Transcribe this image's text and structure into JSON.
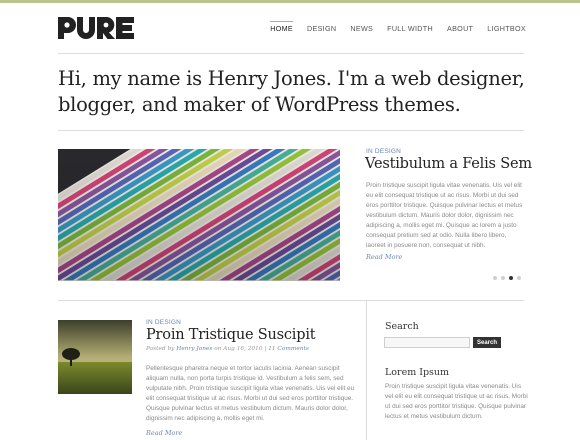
{
  "header": {
    "logo": "PURE",
    "nav": [
      {
        "label": "HOME",
        "active": true
      },
      {
        "label": "DESIGN",
        "active": false
      },
      {
        "label": "NEWS",
        "active": false
      },
      {
        "label": "FULL WIDTH",
        "active": false
      },
      {
        "label": "ABOUT",
        "active": false
      },
      {
        "label": "LIGHTBOX",
        "active": false
      }
    ]
  },
  "intro": "Hi, my name is Henry Jones. I'm a web designer, blogger, and maker of WordPress themes.",
  "featured": {
    "category": "IN DESIGN",
    "title": "Vestibulum a Felis Sem",
    "text": "Proin tristique suscipit ligula vitae venenatis. Uis vel elit eu elit consequat tristique ut ac risus. Morbi ut dui sed eros porttitor tristique. Quisque pulvinar lectus et metus vestibulum dictum. Mauris dolor dolor, dignissim nec adipiscing a, mollis eget mi. Quisque ac lorem a justo consequat pretium sed at odio. Nulla libero libero, laoreet in posuere non, consequat ut nibh.",
    "read_more": "Read More",
    "slides": 4,
    "active_slide": 3
  },
  "post": {
    "category": "IN DESIGN",
    "title": "Proin Tristique Suscipit",
    "meta": {
      "posted_by": "Posted by",
      "author": "Henry Jones",
      "on": "on",
      "date": "Aug 16, 2010",
      "sep": "|",
      "comments": "11 Comments"
    },
    "text": "Pellentesque pharetra neque et tortor iaculis lacinia. Aenean suscipit aliquam nulla, non porta turpis tristique id. Vestibulum a felis sem, sed vulputate nibh. Proin tristique suscipit ligula vitae venenatis. Uis vel elit eu elit consequat tristique ut ac risus. Morbi ut dui sed eros porttitor tristique. Quisque pulvinar lectus et metus vestibulum dictum. Mauris dolor dolor, dignissim nec adipiscing a, mollis eget mi.",
    "read_more": "Read More"
  },
  "sidebar": {
    "search_title": "Search",
    "search_value": "",
    "search_button": "Search",
    "widget_title": "Lorem Ipsum",
    "widget_text": "Proin tristique suscipit ligula vitae venenatis. Uis vel elit eu elit consequat tristique ut ac risus. Morbi ut dui sed eros porttitor tristique. Quisque pulvinar lectus et metus vestibulum dictum."
  },
  "colors": {
    "accent": "#6b86b5",
    "topbar": "#b9c48a",
    "dark": "#333333"
  }
}
